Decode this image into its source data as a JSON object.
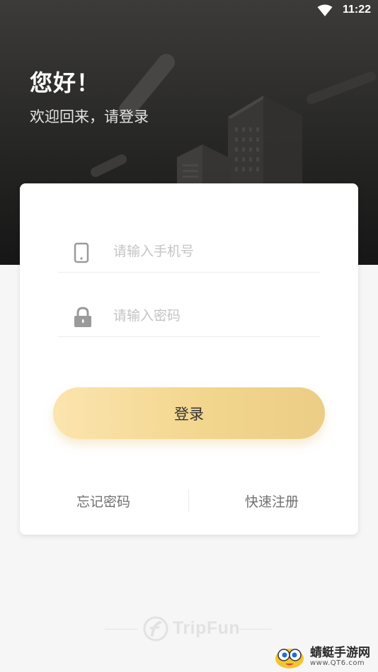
{
  "status_bar": {
    "time": "11:22",
    "wifi_icon": "wifi-icon"
  },
  "header": {
    "greeting": "您好！",
    "subtitle": "欢迎回来，请登录"
  },
  "form": {
    "phone": {
      "placeholder": "请输入手机号",
      "value": "",
      "icon": "phone-icon"
    },
    "password": {
      "placeholder": "请输入密码",
      "value": "",
      "icon": "lock-icon"
    },
    "login_label": "登录"
  },
  "links": {
    "forgot_password": "忘记密码",
    "quick_register": "快速注册"
  },
  "footer": {
    "brand_name": "TripFun",
    "logo_icon": "tripfun-logo-icon"
  },
  "watermark": {
    "name": "蜻蜓手游网",
    "url": "www.QT6.com"
  },
  "colors": {
    "header_dark": "#262625",
    "button_gold_start": "#fbe4ae",
    "button_gold_end": "#ebcd86",
    "background": "#f6f6f6",
    "placeholder": "#c4c4c4"
  }
}
